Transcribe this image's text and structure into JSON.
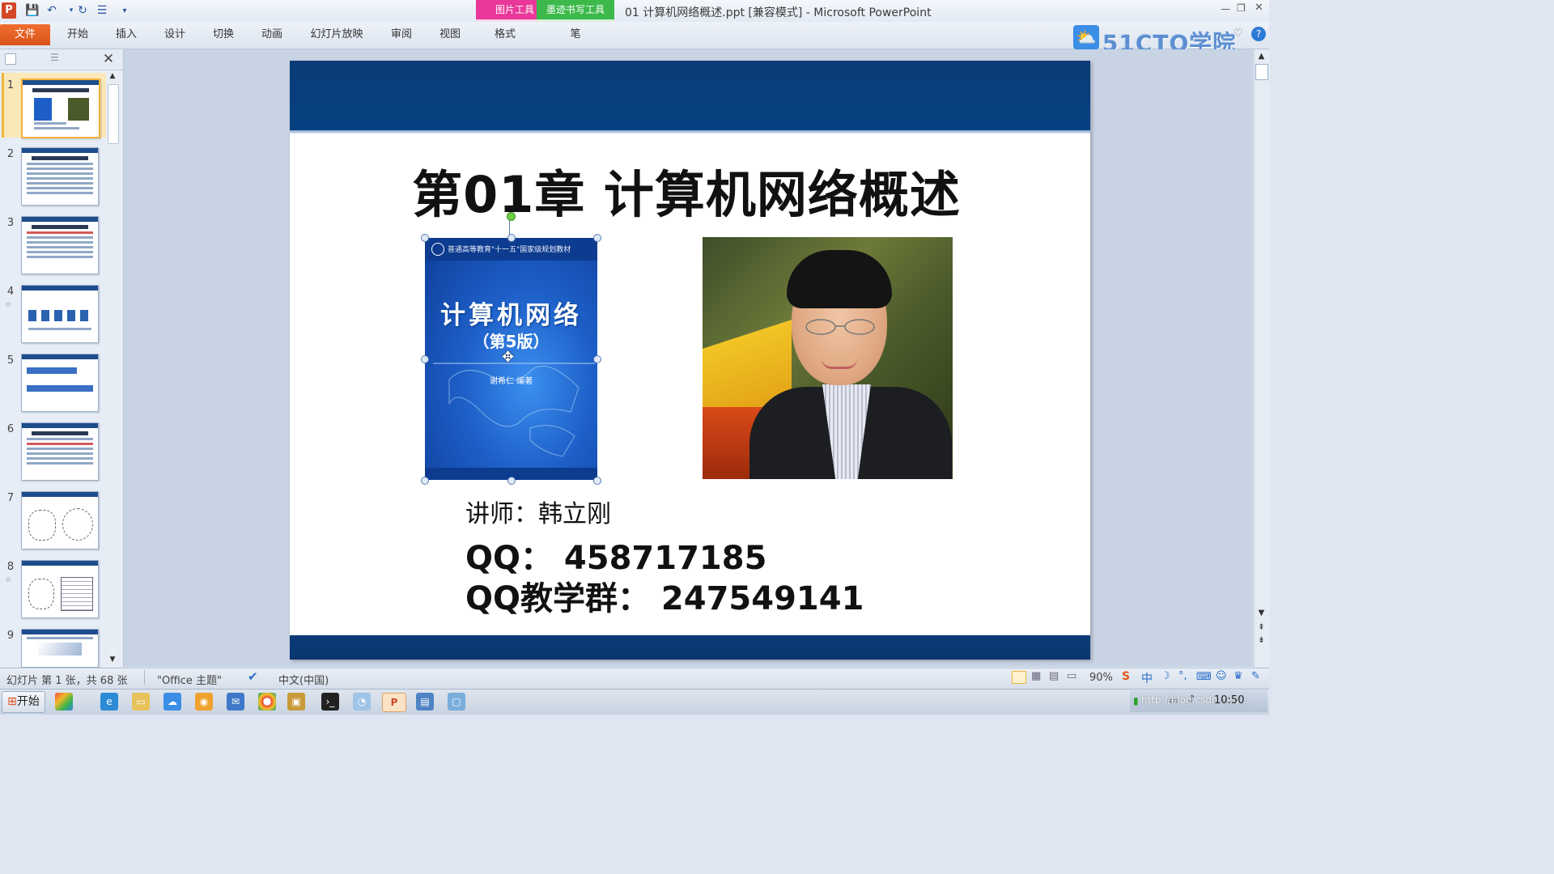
{
  "window": {
    "title": "01 计算机网络概述.ppt [兼容模式] - Microsoft PowerPoint",
    "app_icon": "P"
  },
  "quick_access": [
    "save-icon",
    "undo-icon",
    "redo-icon",
    "format-icon",
    "customize-icon"
  ],
  "context_tabs": [
    {
      "group": "图片工具",
      "tab": "格式",
      "color": "#e9389a"
    },
    {
      "group": "墨迹书写工具",
      "tab": "笔",
      "color": "#3cb94a"
    }
  ],
  "ribbon_tabs": [
    "文件",
    "开始",
    "插入",
    "设计",
    "切换",
    "动画",
    "幻灯片放映",
    "审阅",
    "视图"
  ],
  "brand_logo": "51CTO学院",
  "slides": [
    {
      "num": "1",
      "star": ""
    },
    {
      "num": "2",
      "star": ""
    },
    {
      "num": "3",
      "star": ""
    },
    {
      "num": "4",
      "star": "☆"
    },
    {
      "num": "5",
      "star": ""
    },
    {
      "num": "6",
      "star": ""
    },
    {
      "num": "7",
      "star": ""
    },
    {
      "num": "8",
      "star": "☆"
    },
    {
      "num": "9",
      "star": ""
    }
  ],
  "slide": {
    "title": "第01章 计算机网络概述",
    "book": {
      "series": "普通高等教育\"十一五\"国家级规划教材",
      "title": "计算机网络",
      "edition": "（第5版）",
      "author": "谢希仁  编著"
    },
    "lecturer": "讲师：韩立刚",
    "qq": "QQ：   458717185",
    "qq_group": "QQ教学群：   247549141"
  },
  "status": {
    "slide_info": "幻灯片 第 1 张，共 68 张",
    "theme": "\"Office 主题\"",
    "language": "中文(中国)",
    "zoom": "90%"
  },
  "taskbar": {
    "start": "开始",
    "clock": "10:50",
    "watermark": "http://blog.csdn.net/..."
  },
  "ime": [
    "S",
    "中",
    "☽",
    "°,"
  ]
}
